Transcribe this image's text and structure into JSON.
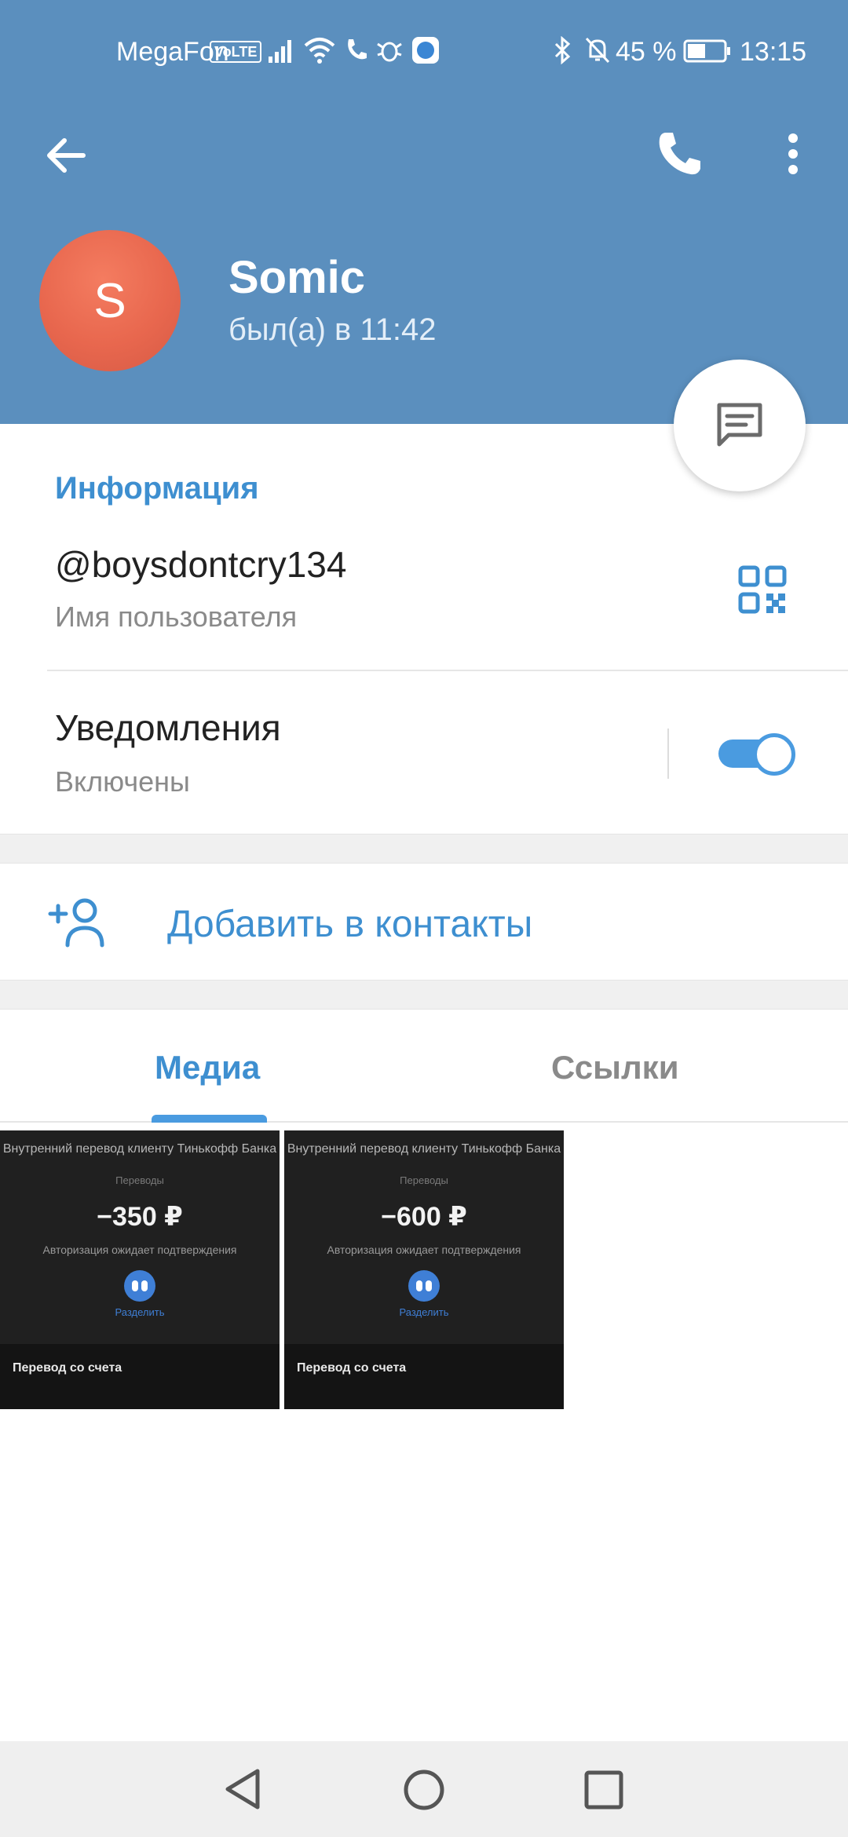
{
  "status_bar": {
    "carrier": "MegaFon",
    "volte": "VoLTE",
    "battery": "45 %",
    "time": "13:15",
    "icons": [
      "signal-icon",
      "wifi-icon",
      "call-icon",
      "bug-icon",
      "app-icon",
      "bluetooth-icon",
      "mute-icon",
      "battery-icon"
    ]
  },
  "header": {
    "avatar_letter": "S",
    "name": "Somic",
    "last_seen": "был(а) в 11:42",
    "bg_color": "#5b8fbe"
  },
  "info": {
    "section_title": "Информация",
    "username": "@boysdontcry134",
    "username_label": "Имя пользователя",
    "notifications_label": "Уведомления",
    "notifications_state": "Включены",
    "notifications_on": true
  },
  "actions": {
    "add_contact": "Добавить в контакты"
  },
  "tabs": [
    {
      "label": "Медиа",
      "active": true
    },
    {
      "label": "Ссылки",
      "active": false
    }
  ],
  "media": [
    {
      "title": "Внутренний перевод клиенту Тинькофф Банка",
      "subtitle": "Переводы",
      "amount": "−350 ₽",
      "status": "Авторизация ожидает подтверждения",
      "action": "Разделить",
      "footer": "Перевод со счета"
    },
    {
      "title": "Внутренний перевод клиенту Тинькофф Банка",
      "subtitle": "Переводы",
      "amount": "−600 ₽",
      "status": "Авторизация ожидает подтверждения",
      "action": "Разделить",
      "footer": "Перевод со счета"
    }
  ],
  "colors": {
    "accent": "#3e8fd0",
    "avatar": "#e8674e"
  }
}
